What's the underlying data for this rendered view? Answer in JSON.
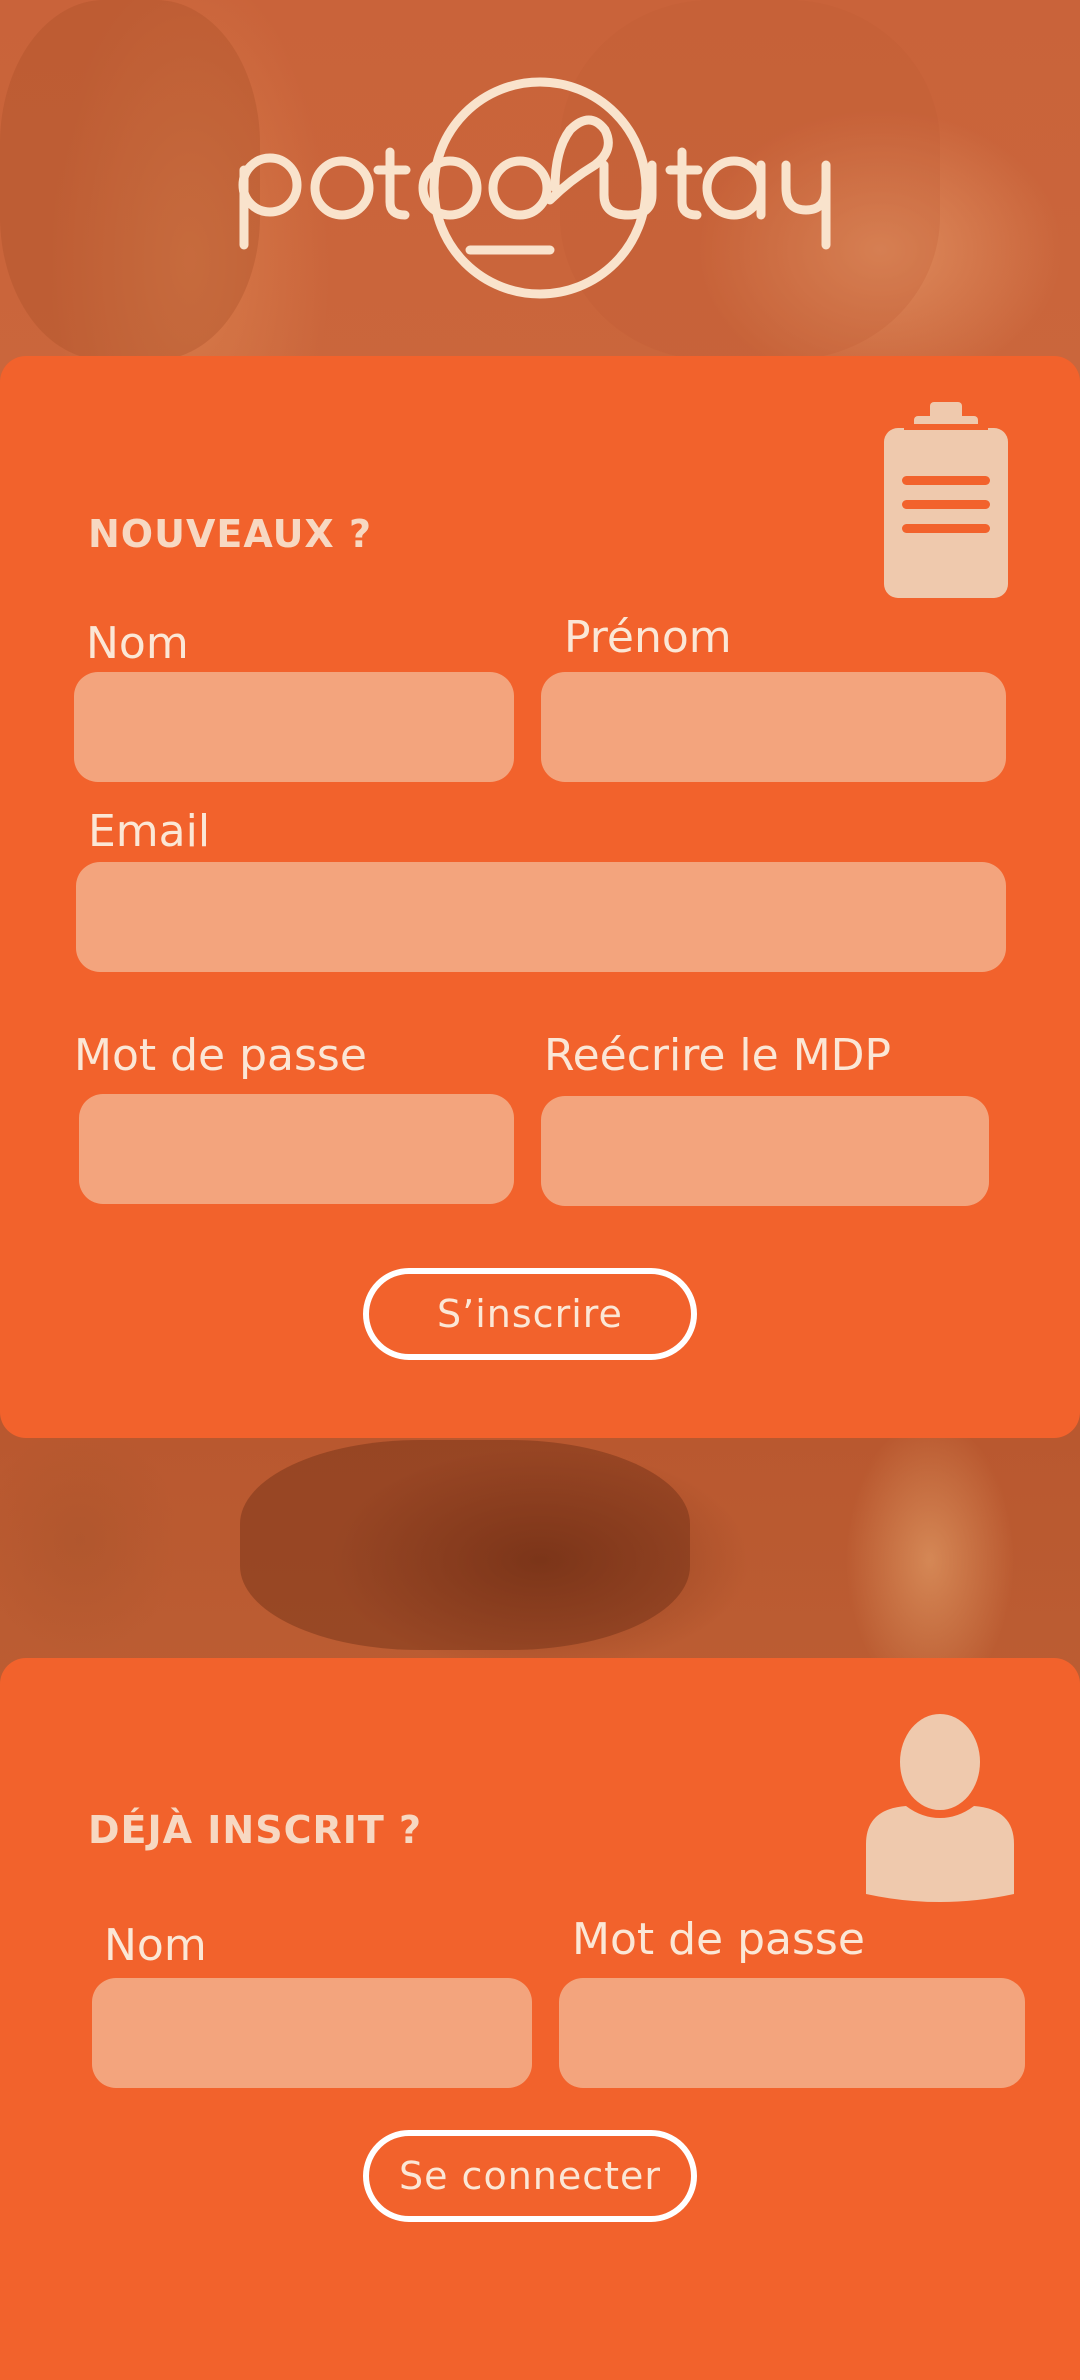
{
  "brand": {
    "logo_text": "potoroutay"
  },
  "register": {
    "title": "NOUVEAUX ?",
    "icon": "clipboard-icon",
    "fields": {
      "nom": {
        "label": "Nom",
        "value": "",
        "placeholder": ""
      },
      "prenom": {
        "label": "Prénom",
        "value": "",
        "placeholder": ""
      },
      "email": {
        "label": "Email",
        "value": "",
        "placeholder": ""
      },
      "mdp": {
        "label": "Mot de passe",
        "value": "",
        "placeholder": ""
      },
      "mdp_confirm": {
        "label": "Reécrire le MDP",
        "value": "",
        "placeholder": ""
      }
    },
    "submit_label": "S’inscrire"
  },
  "login": {
    "title": "DÉJÀ INSCRIT ?",
    "icon": "user-icon",
    "fields": {
      "nom": {
        "label": "Nom",
        "value": "",
        "placeholder": ""
      },
      "mdp": {
        "label": "Mot de passe",
        "value": "",
        "placeholder": ""
      }
    },
    "submit_label": "Se connecter"
  },
  "colors": {
    "card": "#f2622c",
    "field": "#f3a47d",
    "text_light": "#fbe7d6",
    "icon": "#efc9ad"
  }
}
